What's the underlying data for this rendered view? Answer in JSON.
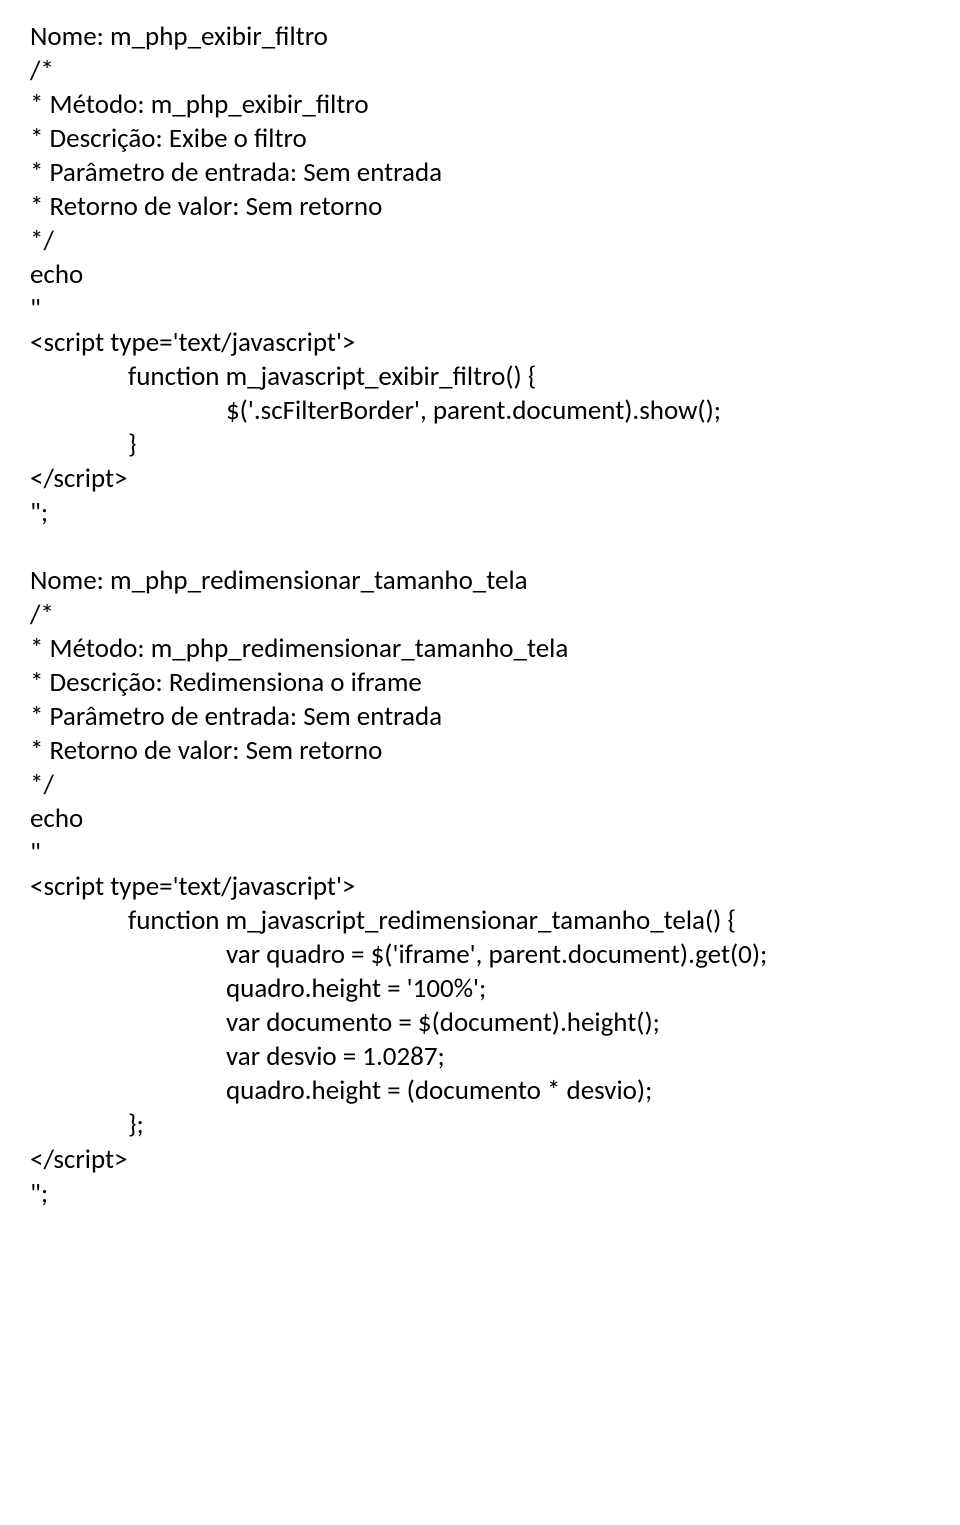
{
  "lines": [
    {
      "cls": "line",
      "text": "Nome: m_php_exibir_filtro"
    },
    {
      "cls": "line",
      "text": "/*"
    },
    {
      "cls": "line",
      "text": "* Método: m_php_exibir_filtro"
    },
    {
      "cls": "line",
      "text": "* Descrição: Exibe o filtro"
    },
    {
      "cls": "line",
      "text": "* Parâmetro de entrada: Sem entrada"
    },
    {
      "cls": "line",
      "text": "* Retorno de valor: Sem retorno"
    },
    {
      "cls": "line",
      "text": "*/"
    },
    {
      "cls": "line",
      "text": "echo"
    },
    {
      "cls": "line",
      "text": "\""
    },
    {
      "cls": "line",
      "text": "<script type='text/javascript'>"
    },
    {
      "cls": "line indent1",
      "text": "function m_javascript_exibir_filtro() {"
    },
    {
      "cls": "line indent2",
      "text": "$('.scFilterBorder', parent.document).show();"
    },
    {
      "cls": "line indent1",
      "text": "}"
    },
    {
      "cls": "line",
      "text": "</script>"
    },
    {
      "cls": "line",
      "text": "\";"
    },
    {
      "cls": "blank",
      "text": ""
    },
    {
      "cls": "line",
      "text": "Nome: m_php_redimensionar_tamanho_tela"
    },
    {
      "cls": "line",
      "text": "/*"
    },
    {
      "cls": "line",
      "text": "* Método: m_php_redimensionar_tamanho_tela"
    },
    {
      "cls": "line",
      "text": "* Descrição: Redimensiona o iframe"
    },
    {
      "cls": "line",
      "text": "* Parâmetro de entrada: Sem entrada"
    },
    {
      "cls": "line",
      "text": "* Retorno de valor: Sem retorno"
    },
    {
      "cls": "line",
      "text": "*/"
    },
    {
      "cls": "line",
      "text": "echo"
    },
    {
      "cls": "line",
      "text": "\""
    },
    {
      "cls": "line",
      "text": "<script type='text/javascript'>"
    },
    {
      "cls": "line indent1",
      "text": "function m_javascript_redimensionar_tamanho_tela() {"
    },
    {
      "cls": "line indent2",
      "text": "var quadro = $('iframe', parent.document).get(0);"
    },
    {
      "cls": "line indent2",
      "text": "quadro.height = '100%';"
    },
    {
      "cls": "line indent2",
      "text": "var documento = $(document).height();"
    },
    {
      "cls": "line indent2",
      "text": "var desvio = 1.0287;"
    },
    {
      "cls": "line indent2",
      "text": "quadro.height = (documento * desvio);"
    },
    {
      "cls": "line indent1",
      "text": "};"
    },
    {
      "cls": "line",
      "text": "</script>"
    },
    {
      "cls": "line",
      "text": "\";"
    }
  ]
}
